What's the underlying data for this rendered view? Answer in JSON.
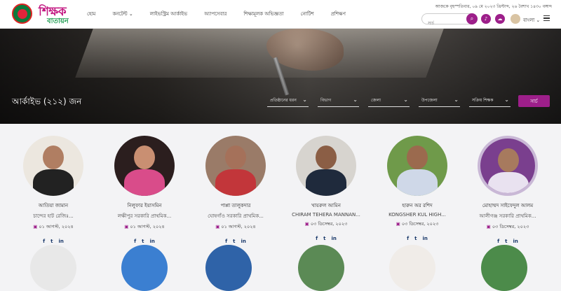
{
  "header": {
    "nav": [
      "হোম",
      "কনটেন্ট",
      "লাইভস্ট্রিম আর্কাইভ",
      "অ্যাপসেবার",
      "শিক্ষামূলক অভিজ্ঞতা",
      "নোটিশ",
      "প্রশিক্ষণ"
    ],
    "brand_line1": "শিক্ষক",
    "brand_line2": "বাতায়ন",
    "date": "আজকে বৃহস্পতিবার, ০৯ মে ২০২৩ খ্রিস্টাব্দ, ২৬ বৈশাখ ১৪৩০ বঙ্গাব্দ",
    "search_placeholder": "সার্চ",
    "language": "বাংলা"
  },
  "hero": {
    "title": "আর্কাইভ (২১২) জন",
    "filters": [
      "প্রতিষ্ঠানের ধরন",
      "বিভাগ",
      "জেলা",
      "উপজেলা",
      "সক্রিয় শিক্ষক"
    ],
    "search_button": "সার্চ"
  },
  "colors": {
    "accent": "#9d1f8a",
    "brand_green": "#1a9b4d",
    "brand_pink": "#c21680"
  },
  "icons": {
    "search": "search-icon",
    "bell": "bell-icon",
    "cloud": "cloud-icon",
    "calendar": "calendar-icon"
  },
  "teachers": [
    {
      "name": "আতিয়া জামান",
      "school": "চান্দের হাট রেজিঃ...",
      "date": "০১ আগস্ট, ২০২৪"
    },
    {
      "name": "নিলুফার ইয়াসমিন",
      "school": "লক্ষীপুর সরকারি প্রাথমিক...",
      "date": "০১ আগস্ট, ২০২৪"
    },
    {
      "name": "পাপ্পা তালুকদার",
      "school": "ঘোষগাঁও সরকারি প্রাথমিক...",
      "date": "০১ আগস্ট, ২০২৪"
    },
    {
      "name": "খায়রুল আমিন",
      "school": "CHIRAM TEHERA MANNAN...",
      "date": "০৩ ডিসেম্বর, ২০২৩"
    },
    {
      "name": "হারুন অর রশিদ",
      "school": "KONGSHER KUL HIGH...",
      "date": "০৩ ডিসেম্বর, ২০২৩"
    },
    {
      "name": "মোহাম্মদ সাইফেদুল আলম",
      "school": "আলীগঞ্জ সরকারি প্রাথমিক...",
      "date": "০৩ ডিসেম্বর, ২০২৩"
    }
  ],
  "social": [
    "f",
    "t",
    "in"
  ]
}
